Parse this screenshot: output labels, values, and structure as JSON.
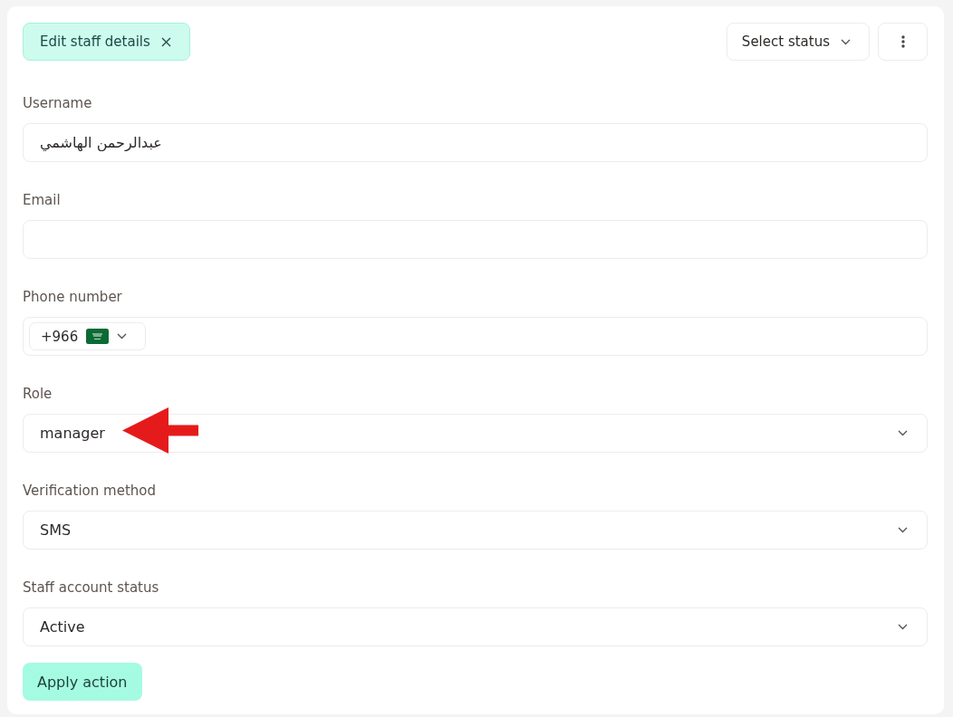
{
  "header": {
    "tab": {
      "label": "Edit staff details",
      "selected": true
    },
    "status_menu": {
      "placeholder": "Select status"
    }
  },
  "fields": [
    {
      "kind": "text",
      "label": "Username",
      "value": "عبدالرحمن الهاشمي",
      "annotated": false
    },
    {
      "kind": "text",
      "label": "Email",
      "annotated": false
    },
    {
      "kind": "phone",
      "label": "Phone number",
      "country_code": "+966",
      "annotated": false
    },
    {
      "kind": "select",
      "label": "Role",
      "value": "manager",
      "annotated": true
    },
    {
      "kind": "select",
      "label": "Verification method",
      "value": "SMS",
      "annotated": false
    },
    {
      "kind": "select",
      "label": "Staff account status",
      "value": "Active",
      "annotated": false
    }
  ],
  "actions": {
    "apply": "Apply action"
  }
}
